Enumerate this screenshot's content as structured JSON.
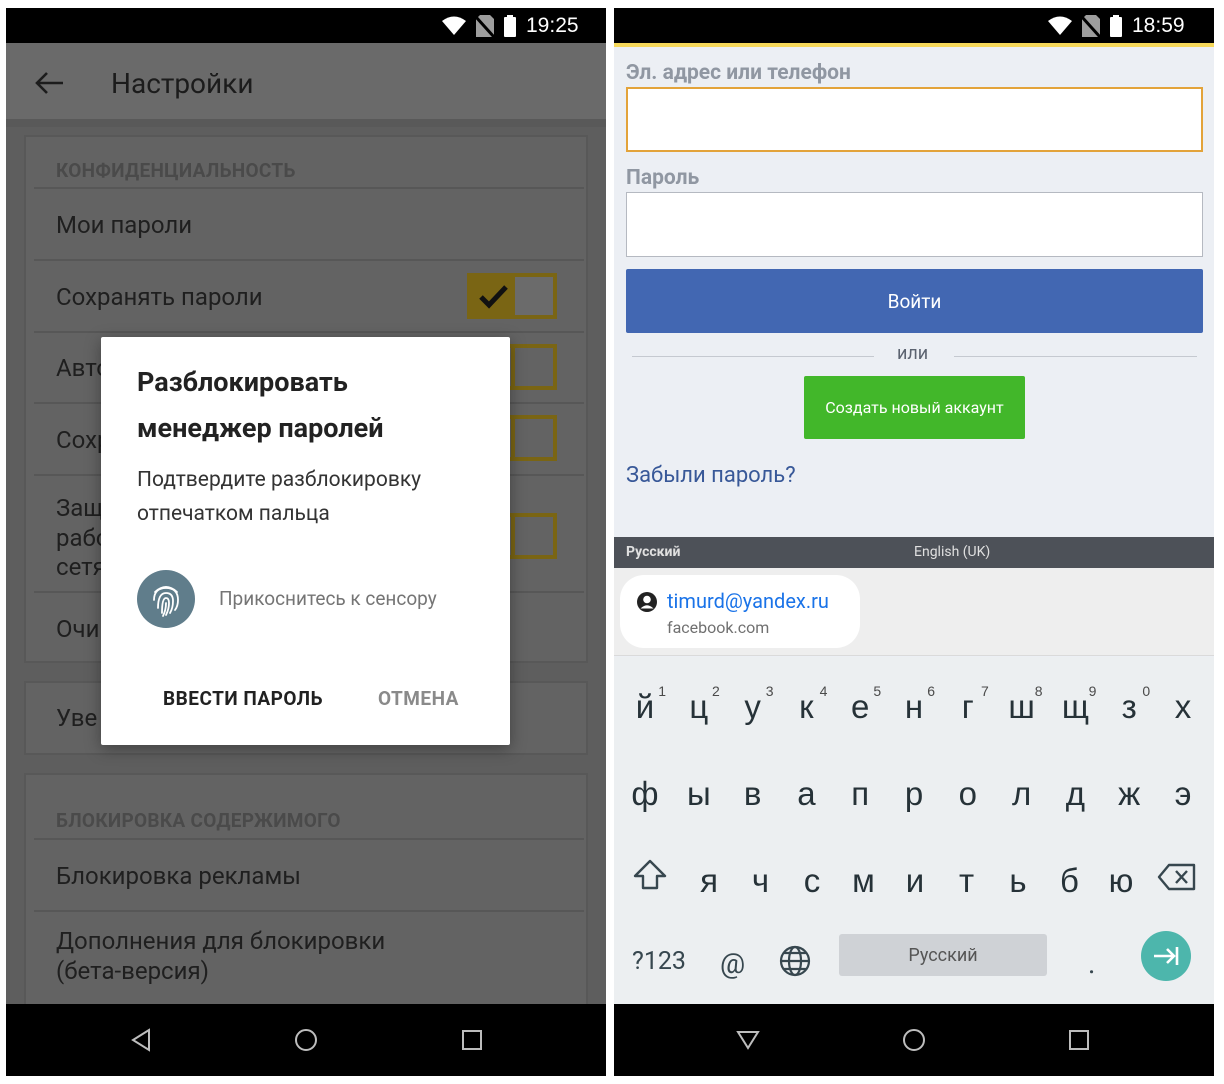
{
  "left_screen": {
    "status": {
      "time": "19:25"
    },
    "toolbar": {
      "title": "Настройки"
    },
    "privacy": {
      "header": "КОНФИДЕНЦИАЛЬНОСТЬ",
      "rows": [
        "Мои пароли",
        "Сохранять пароли",
        "Авто",
        "Сохр",
        "Защ",
        "рабо",
        "сетя",
        "Очи"
      ],
      "toggles": {
        "save_passwords": true,
        "row3": false,
        "row4": false,
        "row5": false
      }
    },
    "notifications": {
      "row": "Уве"
    },
    "content_block": {
      "header": "БЛОКИРОВКА СОДЕРЖИМОГО",
      "rows": [
        "Блокировка рекламы",
        "Дополнения для блокировки",
        "(бета-версия)"
      ]
    },
    "dialog": {
      "title": "Разблокировать менеджер паролей",
      "message": "Подтвердите разблокировку отпечатком пальца",
      "sensor_hint": "Прикоснитесь к сенсору",
      "enter_password": "ВВЕСТИ ПАРОЛЬ",
      "cancel": "ОТМЕНА",
      "colors": {
        "icon_bg": "#607d8b"
      }
    }
  },
  "right_screen": {
    "status": {
      "time": "18:59"
    },
    "form": {
      "email_label": "Эл. адрес или телефон",
      "email_value": "",
      "password_label": "Пароль",
      "password_value": "",
      "login_button": "Войти",
      "or_text": "или",
      "create_button": "Создать новый аккаунт",
      "forgot_link": "Забыли пароль?",
      "colors": {
        "login": "#4267b2",
        "create": "#42b72a",
        "focus": "#e3a33a"
      }
    },
    "keyboard": {
      "lang_left": "Русский",
      "lang_right": "English (UK)",
      "suggestion": {
        "email": "timurd@yandex.ru",
        "site": "facebook.com"
      },
      "row1": [
        "й",
        "ц",
        "у",
        "к",
        "е",
        "н",
        "г",
        "ш",
        "щ",
        "з",
        "х"
      ],
      "row1_hints": [
        "1",
        "2",
        "3",
        "4",
        "5",
        "6",
        "7",
        "8",
        "9",
        "0",
        ""
      ],
      "row2": [
        "ф",
        "ы",
        "в",
        "а",
        "п",
        "р",
        "о",
        "л",
        "д",
        "ж",
        "э"
      ],
      "row3": [
        "я",
        "ч",
        "с",
        "м",
        "и",
        "т",
        "ь",
        "б",
        "ю"
      ],
      "symbols_key": "?123",
      "at_key": "@",
      "space_label": "Русский",
      "period_key": "."
    }
  }
}
